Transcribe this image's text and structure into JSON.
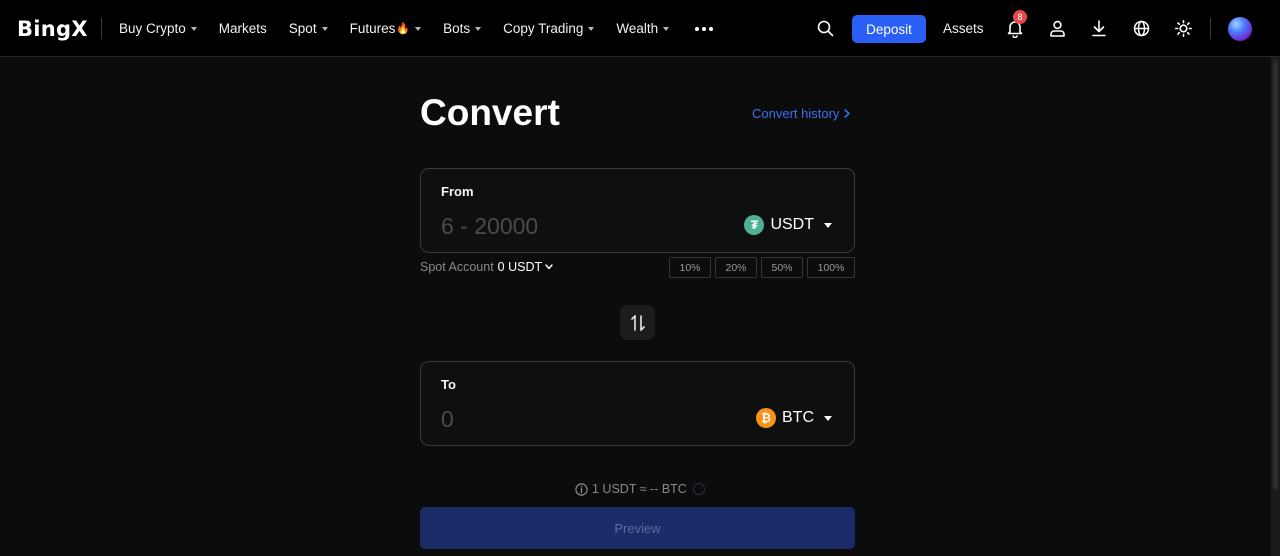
{
  "header": {
    "logo": "BingX",
    "nav": [
      {
        "label": "Buy Crypto",
        "dropdown": true
      },
      {
        "label": "Markets",
        "dropdown": false
      },
      {
        "label": "Spot",
        "dropdown": true
      },
      {
        "label": "Futures",
        "dropdown": true,
        "badge_icon": "fire-icon"
      },
      {
        "label": "Bots",
        "dropdown": true
      },
      {
        "label": "Copy Trading",
        "dropdown": true
      },
      {
        "label": "Wealth",
        "dropdown": true
      }
    ],
    "more_icon": "more-dots-icon",
    "deposit_label": "Deposit",
    "assets_label": "Assets",
    "notification_count": "8",
    "icons": [
      "search-icon",
      "bell-icon",
      "user-icon",
      "download-icon",
      "globe-icon",
      "theme-sun-icon"
    ]
  },
  "convert": {
    "title": "Convert",
    "history_label": "Convert history",
    "from": {
      "label": "From",
      "placeholder": "6 - 20000",
      "value": "",
      "coin": "USDT",
      "coin_glyph": "₮"
    },
    "account": {
      "label": "Spot Account",
      "balance": "0 USDT"
    },
    "percent_options": [
      "10%",
      "20%",
      "50%",
      "100%"
    ],
    "to": {
      "label": "To",
      "placeholder": "0",
      "value": "",
      "coin": "BTC",
      "coin_glyph": "₿"
    },
    "rate_text": "1 USDT ≈ -- BTC",
    "preview_label": "Preview"
  },
  "colors": {
    "background": "#0c0c0c",
    "topbar": "#000000",
    "accent": "#2a5ff5",
    "link": "#3b6ff5",
    "preview_disabled": "#1b2c68",
    "usdt": "#50af95",
    "btc": "#f7931a",
    "notification_badge": "#e5484d"
  }
}
